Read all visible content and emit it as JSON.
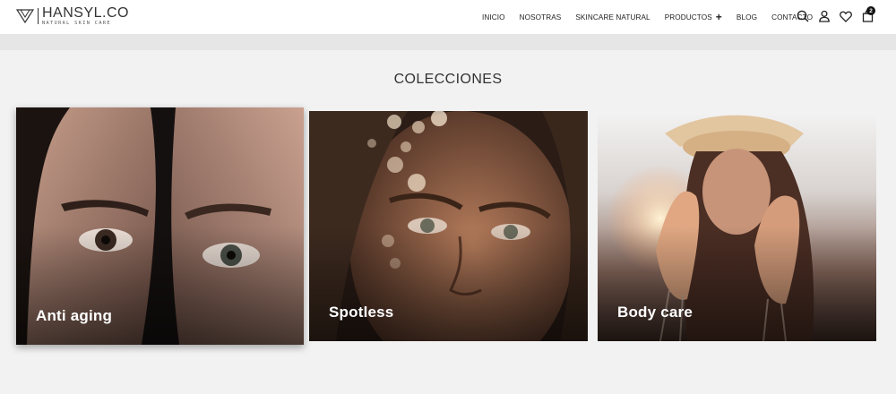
{
  "brand": {
    "name": "HANSYL.CO",
    "tagline": "NATURAL SKIN CARE"
  },
  "nav": {
    "items": [
      {
        "label": "INICIO"
      },
      {
        "label": "NOSOTRAS"
      },
      {
        "label": "SKINCARE NATURAL"
      },
      {
        "label": "PRODUCTOS"
      },
      {
        "label": "BLOG"
      },
      {
        "label": "CONTACTO"
      }
    ]
  },
  "header_icons": {
    "search": "search-icon",
    "account": "user-icon",
    "wishlist": "heart-icon",
    "cart": "shopping-bag-icon",
    "cart_count": "2"
  },
  "collections": {
    "title": "COLECCIONES",
    "cards": [
      {
        "label": "Anti aging"
      },
      {
        "label": "Spotless"
      },
      {
        "label": "Body care"
      }
    ]
  },
  "colors": {
    "header_bg": "#ffffff",
    "band_bg": "#e6e6e6",
    "page_bg": "#f2f2f2",
    "text": "#222222",
    "badge_bg": "#111111"
  }
}
